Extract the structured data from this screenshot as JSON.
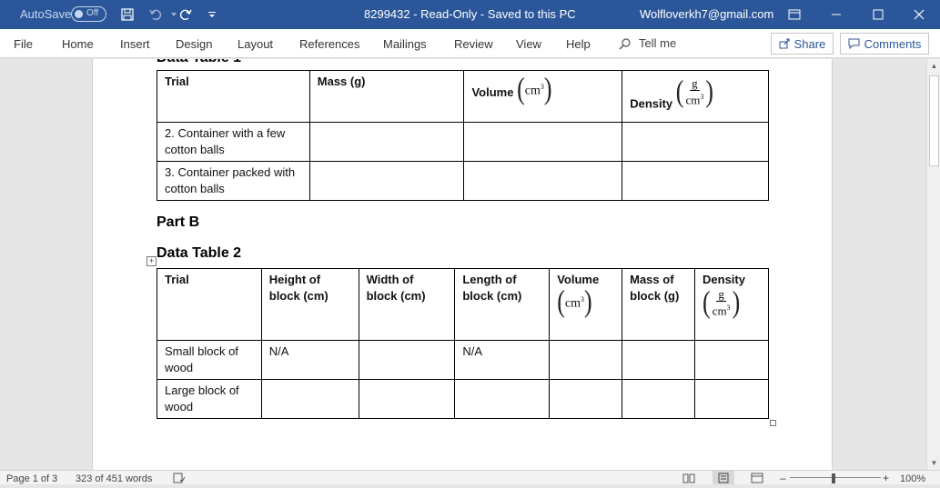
{
  "titlebar": {
    "autosave_label": "AutoSave",
    "autosave_state": "Off",
    "document_title": "8299432  -  Read-Only  -  Saved to this PC",
    "user_email": "Wolfloverkh7@gmail.com"
  },
  "ribbon": {
    "tabs": [
      "File",
      "Home",
      "Insert",
      "Design",
      "Layout",
      "References",
      "Mailings",
      "Review",
      "View",
      "Help"
    ],
    "tell_me": "Tell me",
    "share": "Share",
    "comments": "Comments"
  },
  "table1": {
    "headers": [
      "Trial",
      "Mass (g)",
      "Volume",
      "Density"
    ],
    "volume_unit": "cm",
    "density_num": "g",
    "density_den": "cm",
    "rows": [
      [
        "2. Container with a few cotton balls",
        "",
        "",
        ""
      ],
      [
        "3. Container packed with cotton balls",
        "",
        "",
        ""
      ]
    ]
  },
  "part_b": "Part B",
  "table2_title": "Data Table 2",
  "table2": {
    "headers": [
      "Trial",
      "Height of block (cm)",
      "Width of block (cm)",
      "Length of block (cm)",
      "Volume",
      "Mass of block (g)",
      "Density"
    ],
    "volume_unit": "cm",
    "density_num": "g",
    "density_den": "cm",
    "rows": [
      [
        "Small block of wood",
        "N/A",
        "",
        "N/A",
        "",
        "",
        ""
      ],
      [
        "Large block of wood",
        "",
        "",
        "",
        "",
        "",
        ""
      ]
    ]
  },
  "superscript": "3",
  "status": {
    "page": "Page 1 of 3",
    "words": "323 of 451 words",
    "zoom": "100%"
  }
}
